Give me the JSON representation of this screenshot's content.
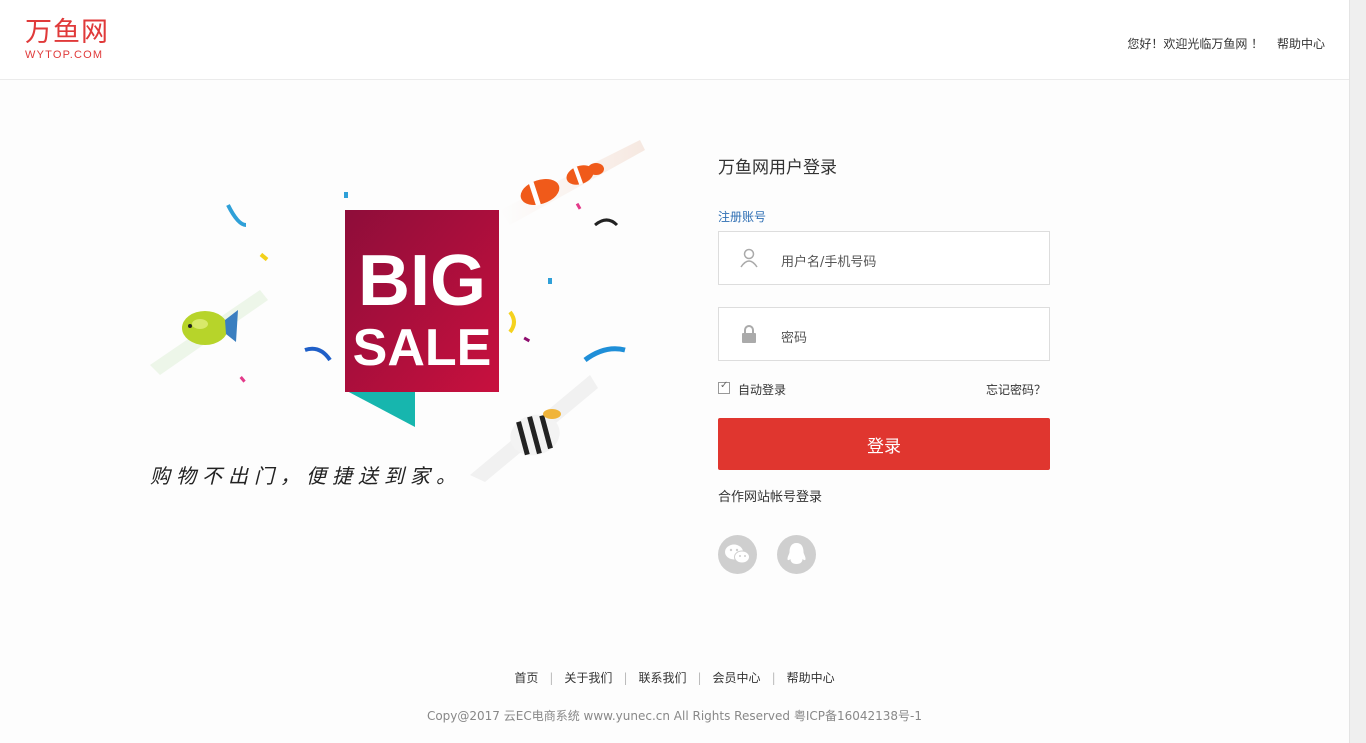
{
  "header": {
    "logo_cn": "万鱼网",
    "logo_en": "WYTOP.COM",
    "welcome": "您好！欢迎光临万鱼网 ！",
    "help": "帮助中心"
  },
  "hero": {
    "big": "BIG",
    "sale": "SALE",
    "slogan": "购物不出门，便捷送到家。"
  },
  "login": {
    "title": "万鱼网用户登录",
    "register": "注册账号",
    "username_placeholder": "用户名/手机号码",
    "password_placeholder": "密码",
    "auto_login": "自动登录",
    "forgot": "忘记密码？",
    "submit": "登录",
    "partner": "合作网站帐号登录",
    "socials": [
      "wechat-icon",
      "qq-icon"
    ]
  },
  "footer": {
    "links": [
      "首页",
      "关于我们",
      "联系我们",
      "会员中心",
      "帮助中心"
    ],
    "copyright": "Copy@2017 云EC电商系统 www.yunec.cn All Rights Reserved 粤ICP备16042138号-1"
  },
  "colors": {
    "brand": "#e03a3a",
    "button": "#e0362f",
    "link": "#2f6fb4"
  }
}
